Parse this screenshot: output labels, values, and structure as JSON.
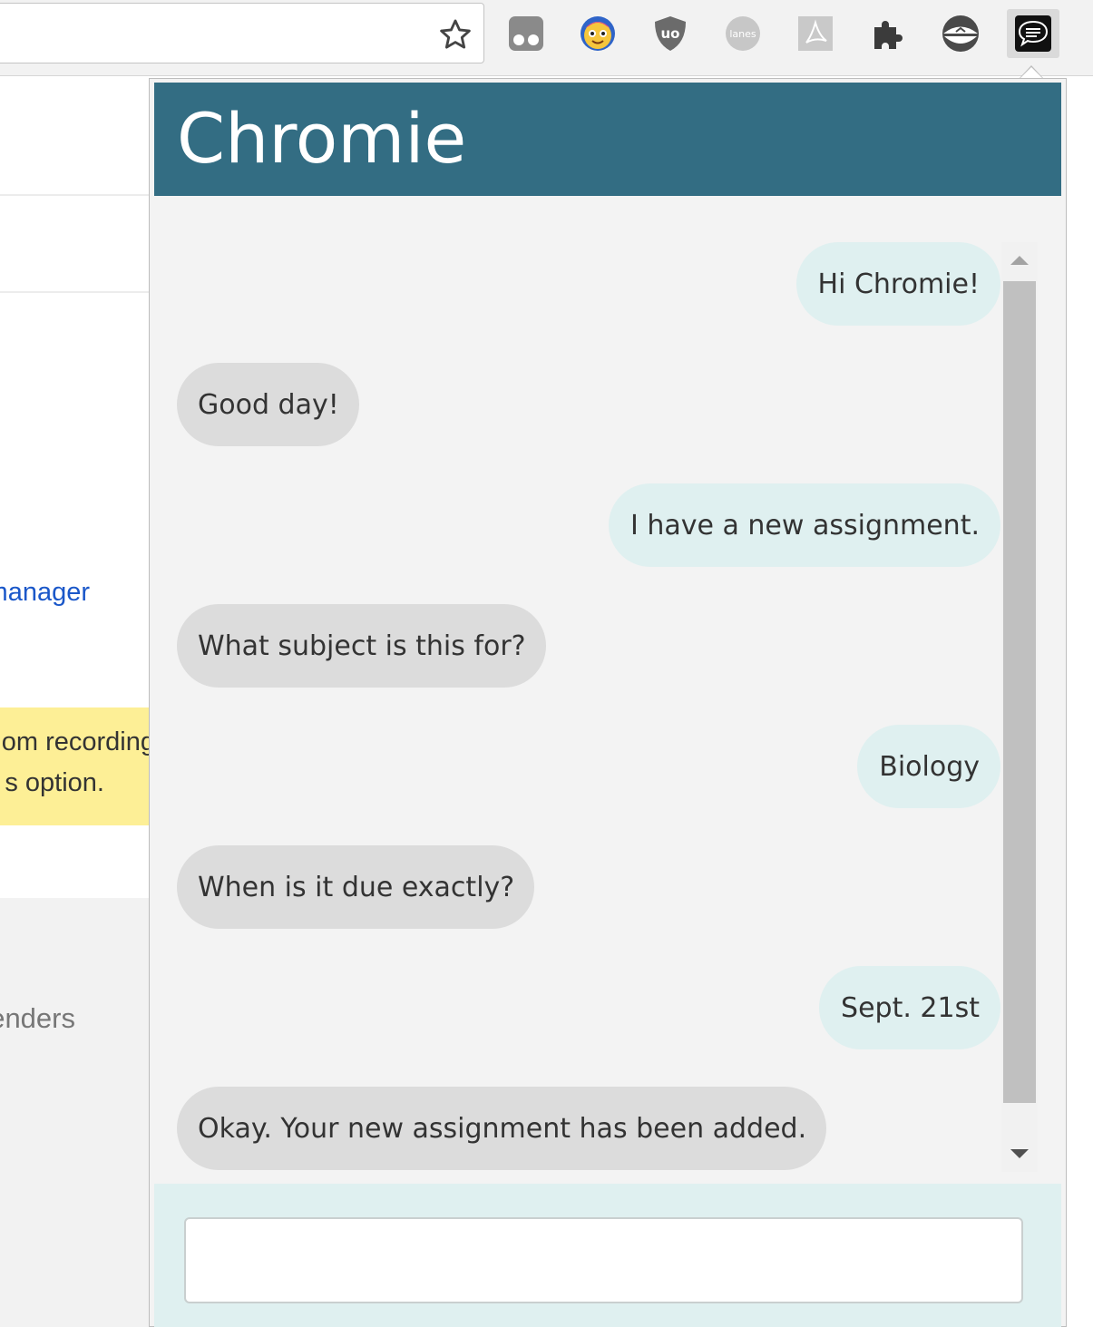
{
  "toolbar": {
    "extensions": [
      {
        "name": "Extension 1"
      },
      {
        "name": "Extension 2"
      },
      {
        "name": "uBlock Origin"
      },
      {
        "name": "lanes"
      },
      {
        "name": "Adobe Acrobat"
      },
      {
        "name": "Extensions"
      },
      {
        "name": "Extension 7"
      },
      {
        "name": "Chromie"
      }
    ],
    "lanes_label": "lanes"
  },
  "background_page": {
    "link_text": "manager",
    "notice_line1": "om recording",
    "notice_line2": "s option.",
    "grey_text": "enders"
  },
  "popup": {
    "title": "Chromie",
    "messages": [
      {
        "from": "user",
        "text": "Hi Chromie!"
      },
      {
        "from": "bot",
        "text": "Good day!"
      },
      {
        "from": "user",
        "text": "I have a new assignment."
      },
      {
        "from": "bot",
        "text": "What subject is this for?"
      },
      {
        "from": "user",
        "text": "Biology"
      },
      {
        "from": "bot",
        "text": "When is it due exactly?"
      },
      {
        "from": "user",
        "text": "Sept. 21st"
      },
      {
        "from": "bot",
        "text": "Okay. Your new assignment has been added."
      }
    ],
    "input": {
      "value": "",
      "placeholder": ""
    }
  },
  "colors": {
    "header_bg": "#336d83",
    "user_bubble": "#dff0f0",
    "bot_bubble": "#dcdcdc"
  }
}
